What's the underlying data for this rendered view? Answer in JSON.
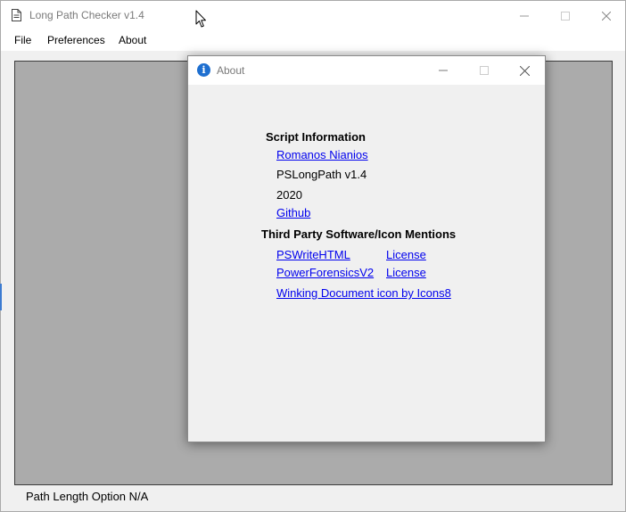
{
  "window": {
    "title": "Long Path Checker v1.4"
  },
  "menu": {
    "file": "File",
    "preferences": "Preferences",
    "about": "About"
  },
  "status": {
    "text": "Path Length Option N/A"
  },
  "about_dialog": {
    "title": "About",
    "script_info_heading": "Script Information",
    "author": "Romanos Nianios",
    "version": "PSLongPath v1.4",
    "year": "2020",
    "github": "Github",
    "third_party_heading": "Third  Party Software/Icon Mentions",
    "items": [
      {
        "name": "PSWriteHTML",
        "license": "License"
      },
      {
        "name": "PowerForensicsV2",
        "license": "License"
      }
    ],
    "icon_credit": "Winking Document icon by Icons8"
  }
}
